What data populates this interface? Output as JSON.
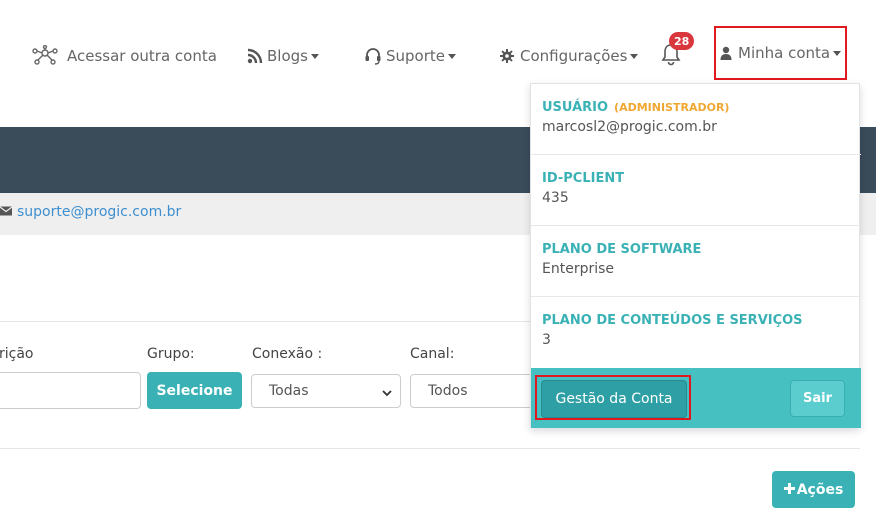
{
  "nav": {
    "other_account": "Acessar outra conta",
    "blogs": "Blogs",
    "support": "Suporte",
    "config": "Configurações",
    "notifications_count": "28",
    "account": "Minha conta"
  },
  "support": {
    "email": "suporte@progic.com.br"
  },
  "filters": {
    "description_label": "rição",
    "group_label": "Grupo:",
    "group_button": "Selecione",
    "connection_label": "Conexão :",
    "connection_value": "Todas",
    "channel_label": "Canal:",
    "channel_value": "Todos"
  },
  "actions_button": "Ações",
  "dropdown": {
    "user_label": "USUÁRIO",
    "user_role": "(ADMINISTRADOR)",
    "user_email": "marcosl2@progic.com.br",
    "client_label": "ID-PCLIENT",
    "client_value": "435",
    "software_label": "PLANO DE SOFTWARE",
    "software_value": "Enterprise",
    "content_label": "PLANO DE CONTEÚDOS E SERVIÇOS",
    "content_value": "3",
    "manage_button": "Gestão da Conta",
    "logout_button": "Sair"
  },
  "colors": {
    "teal": "#3ab2b5",
    "dark_band": "#3a4b5a",
    "highlight": "#e0191f",
    "badge": "#d9363e",
    "link": "#3d8fd0"
  }
}
